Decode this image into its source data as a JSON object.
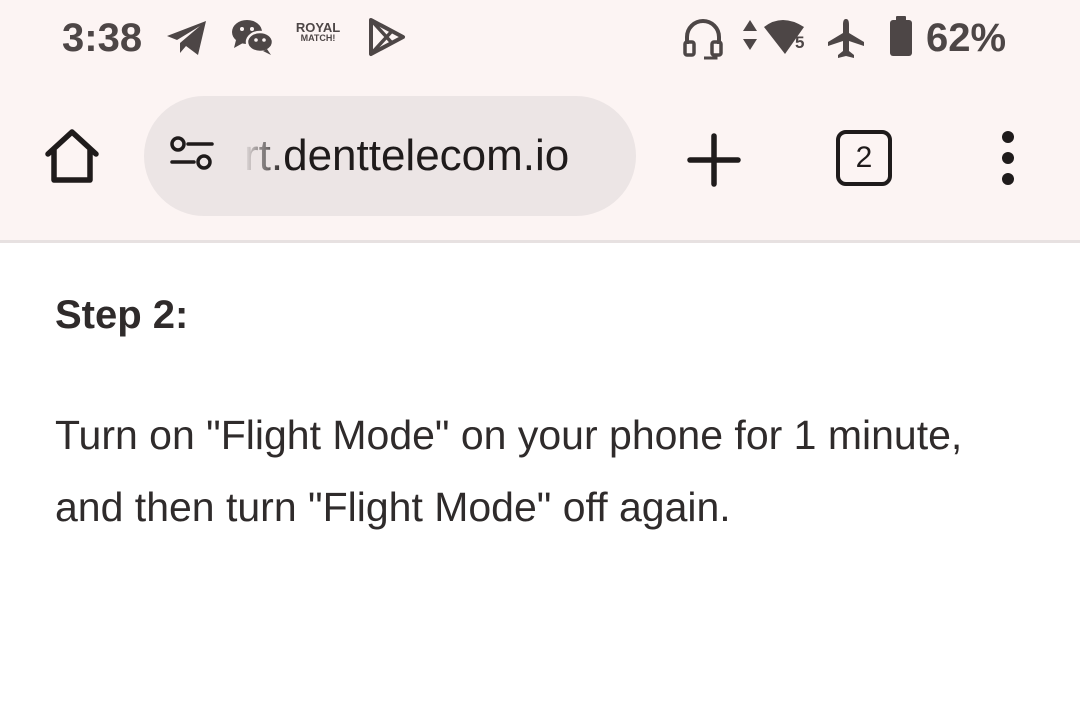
{
  "status_bar": {
    "time": "3:38",
    "notification_icons": [
      "telegram-icon",
      "wechat-icon",
      "royal-match-icon",
      "play-store-icon"
    ],
    "royal_match_line1": "ROYAL",
    "royal_match_line2": "MATCH!",
    "system_icons": [
      "headset-icon",
      "data-arrows-icon",
      "wifi-icon",
      "airplane-icon",
      "battery-icon"
    ],
    "wifi_badge": "5",
    "battery_percent": "62%"
  },
  "browser": {
    "url": "rt.denttelecom.io",
    "tab_count": "2",
    "buttons": [
      "home-icon",
      "site-settings-icon",
      "plus-icon",
      "tab-switcher",
      "more-vert-icon"
    ]
  },
  "page": {
    "step_title": "Step 2:",
    "step_body": "Turn on \"Flight Mode\" on your phone for 1 minute, and then turn \"Flight Mode\" off again."
  },
  "colors": {
    "chrome_bg": "#fcf4f3",
    "omnibox_bg": "#ece5e5",
    "status_text": "#4d4646",
    "body_text": "#2f2b2b"
  }
}
